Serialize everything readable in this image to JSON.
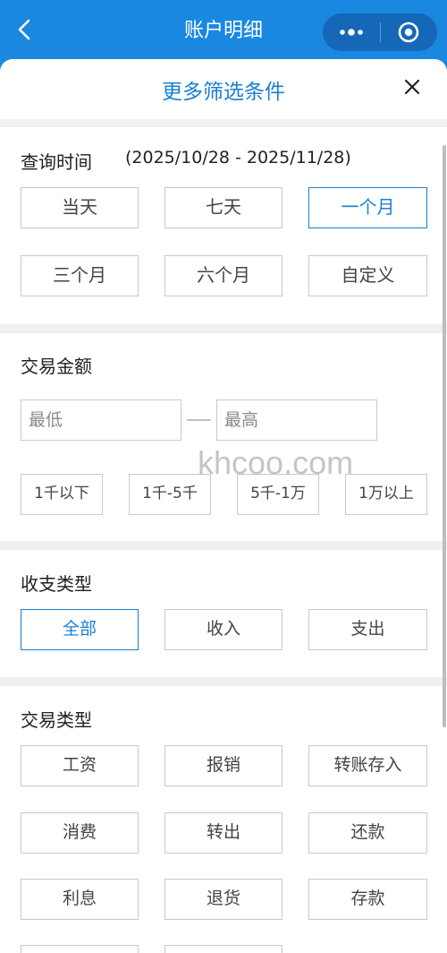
{
  "appbar": {
    "title": "账户明细",
    "back_icon": "back-chevron-icon",
    "more_icon": "more-dots-icon",
    "target_icon": "target-icon",
    "color": "#1a87e0"
  },
  "sheet": {
    "title": "更多筛选条件",
    "close_icon": "close-icon",
    "accent": "#1a7fd4"
  },
  "query_time": {
    "title": "查询时间",
    "range": "(2025/10/28 - 2025/11/28)",
    "options": [
      "当天",
      "七天",
      "一个月",
      "三个月",
      "六个月",
      "自定义"
    ],
    "selected": "一个月"
  },
  "amount": {
    "title": "交易金额",
    "min_placeholder": "最低",
    "max_placeholder": "最高",
    "options": [
      "1千以下",
      "1千-5千",
      "5千-1万",
      "1万以上"
    ]
  },
  "watermark": "khcoo.com",
  "income_type": {
    "title": "收支类型",
    "options": [
      "全部",
      "收入",
      "支出"
    ],
    "selected": "全部"
  },
  "txn_type": {
    "title": "交易类型",
    "options": [
      "工资",
      "报销",
      "转账存入",
      "消费",
      "转出",
      "还款",
      "利息",
      "退货",
      "存款"
    ]
  }
}
